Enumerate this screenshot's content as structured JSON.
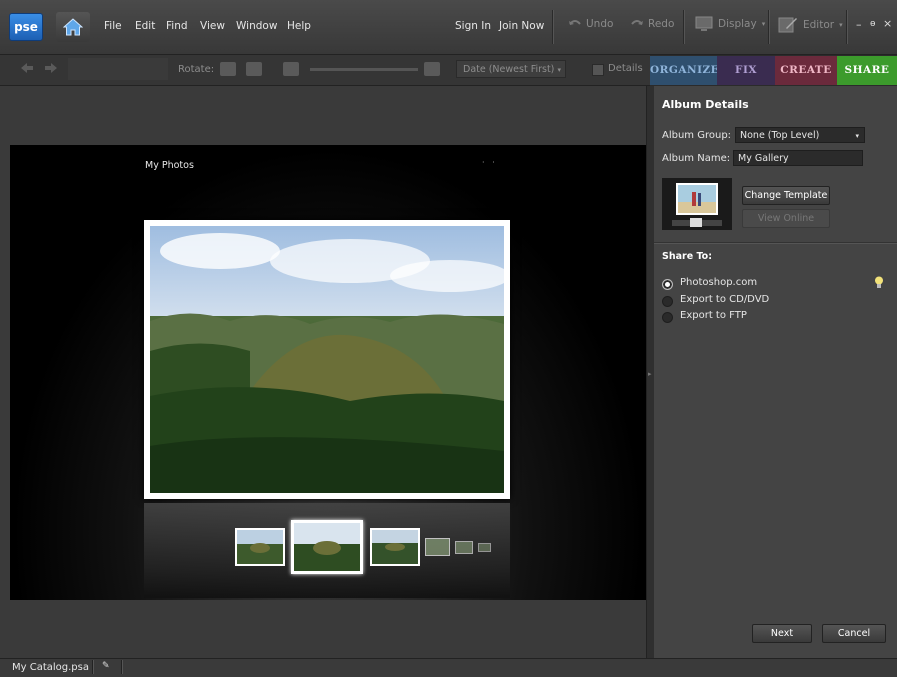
{
  "app": {
    "logo_text": "pse"
  },
  "menu": [
    "File",
    "Edit",
    "Find",
    "View",
    "Window",
    "Help"
  ],
  "account": {
    "sign_in": "Sign In",
    "join_now": "Join Now"
  },
  "top_actions": {
    "undo": "Undo",
    "redo": "Redo",
    "display": "Display",
    "editor": "Editor"
  },
  "window_controls": {
    "minimize": "–",
    "restore": "ɵ",
    "close": "×"
  },
  "toolbar": {
    "rotate_label": "Rotate:",
    "sort_value": "Date (Newest First)",
    "details_label": "Details"
  },
  "tabs": [
    {
      "label": "ORGANIZE",
      "color": "#2f4f6e"
    },
    {
      "label": "FIX",
      "color": "#3a2c50"
    },
    {
      "label": "CREATE",
      "color": "#6b2a3c"
    },
    {
      "label": "SHARE",
      "color": "#3c9b2c",
      "active": true
    }
  ],
  "preview": {
    "gallery_title": "My Photos"
  },
  "panel": {
    "title": "Album Details",
    "album_group_label": "Album Group:",
    "album_group_value": "None (Top Level)",
    "album_name_label": "Album Name:",
    "album_name_value": "My Gallery",
    "change_template": "Change Template",
    "view_online": "View Online",
    "share_to_title": "Share To:",
    "share_options": [
      {
        "label": "Photoshop.com",
        "selected": true
      },
      {
        "label": "Export to CD/DVD",
        "selected": false
      },
      {
        "label": "Export to FTP",
        "selected": false
      }
    ],
    "next": "Next",
    "cancel": "Cancel"
  },
  "status": {
    "catalog": "My Catalog.psa"
  }
}
